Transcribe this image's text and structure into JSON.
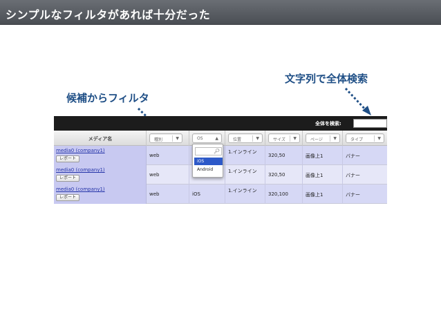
{
  "slide": {
    "title": "シンプルなフィルタがあれば十分だった"
  },
  "annotations": {
    "search": "文字列で全体検索",
    "filter": "候補からフィルタ"
  },
  "app": {
    "search_label": "全体を検索:",
    "search_value": "",
    "name_header": "メディア名",
    "filters": [
      {
        "label": "種別"
      },
      {
        "label": "OS"
      },
      {
        "label": "位置"
      },
      {
        "label": "サイズ"
      },
      {
        "label": "ページ"
      },
      {
        "label": "タイプ"
      }
    ],
    "dropdown": {
      "search_value": "",
      "options": [
        "iOS",
        "Android"
      ],
      "selected": "iOS"
    },
    "report_label": "レポート",
    "rows": [
      {
        "name": "media0 (company1)",
        "kind": "web",
        "os": "",
        "position": "1.インライン",
        "size": "320,50",
        "page": "画像上1",
        "type": "バナー"
      },
      {
        "name": "media0 (company1)",
        "kind": "web",
        "os": "",
        "position": "1.インライン",
        "size": "320,50",
        "page": "画像上1",
        "type": "バナー"
      },
      {
        "name": "media0 (company1)",
        "kind": "web",
        "os": "iOS",
        "position": "1.インライン",
        "size": "320,100",
        "page": "画像上1",
        "type": "バナー"
      }
    ]
  },
  "colors": {
    "annotation": "#1f4f86",
    "title_bar": "#55595f",
    "row_odd": "#d6d8f5",
    "row_even": "#e6e7f8",
    "link": "#2433a8",
    "dropdown_selected": "#2d59c8"
  }
}
